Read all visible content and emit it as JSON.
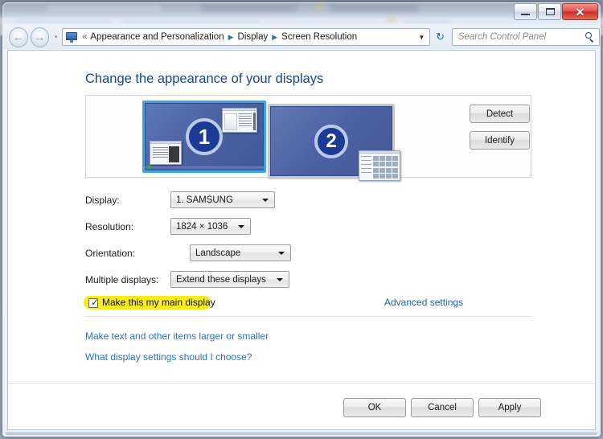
{
  "window": {
    "controls": {
      "minimize_label": "Minimize",
      "maximize_label": "Restore",
      "close_label": "✕"
    }
  },
  "nav": {
    "back_glyph": "←",
    "forward_glyph": "→",
    "recent_glyph": "▾",
    "refresh_glyph": "↻",
    "address_icon": "display-icon",
    "double_chevron": "«",
    "breadcrumbs": [
      {
        "label": "Appearance and Personalization"
      },
      {
        "label": "Display"
      },
      {
        "label": "Screen Resolution"
      }
    ],
    "crumb_arrow": "▶",
    "address_caret": "▼"
  },
  "search": {
    "placeholder": "Search Control Panel",
    "icon": "search-icon"
  },
  "main": {
    "heading": "Change the appearance of your displays",
    "preview": {
      "monitors": [
        {
          "number": "1",
          "selected": true
        },
        {
          "number": "2",
          "selected": false
        }
      ]
    },
    "side_buttons": {
      "detect_label": "Detect",
      "identify_label": "Identify"
    },
    "fields": [
      {
        "label": "Display:",
        "value": "1. SAMSUNG"
      },
      {
        "label": "Resolution:",
        "value": "1824 × 1036"
      },
      {
        "label": "Orientation:",
        "value": "Landscape"
      },
      {
        "label": "Multiple displays:",
        "value": "Extend these displays"
      }
    ],
    "main_display_checkbox": {
      "label": "Make this my main display",
      "checked": true,
      "check_glyph": "✓",
      "highlight_color": "#f9ec1c"
    },
    "advanced_settings_link": "Advanced settings",
    "links": [
      "Make text and other items larger or smaller",
      "What display settings should I choose?"
    ]
  },
  "footer": {
    "ok_label": "OK",
    "cancel_label": "Cancel",
    "apply_label": "Apply"
  },
  "colors": {
    "heading": "#17458f",
    "link": "#2a73c2",
    "selected_monitor_border": "#3aa6e8",
    "monitor_fill": "#4b62a3",
    "highlight": "#f9ec1c",
    "close_button": "#c92f25"
  }
}
